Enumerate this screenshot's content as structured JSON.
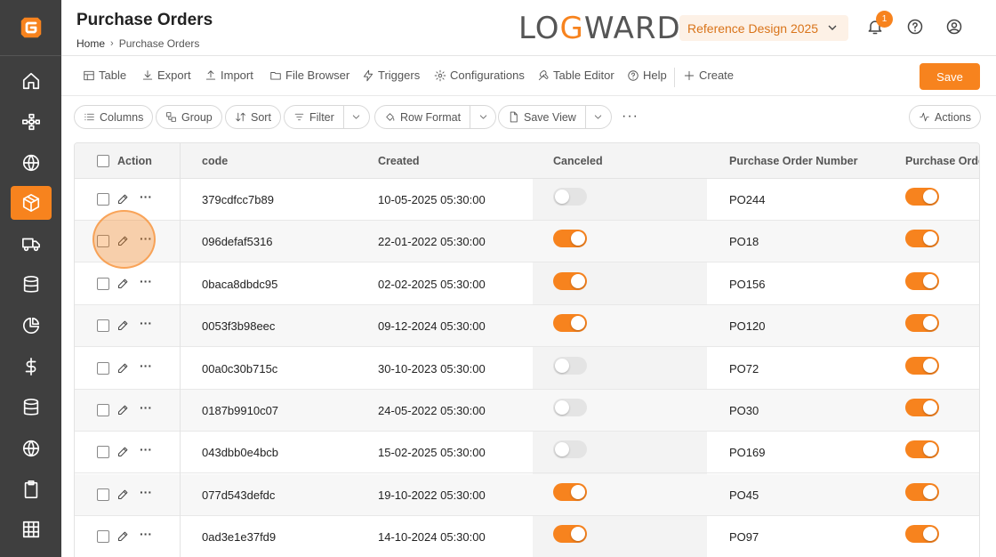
{
  "header": {
    "title": "Purchase Orders",
    "breadcrumb": {
      "home": "Home",
      "current": "Purchase Orders"
    },
    "brand_prefix": "LO",
    "brand_g": "G",
    "brand_suffix": "WARD",
    "reference_select": "Reference Design 2025",
    "notification_count": "1"
  },
  "toolbar": {
    "table": "Table",
    "export": "Export",
    "import": "Import",
    "file_browser": "File Browser",
    "triggers": "Triggers",
    "configurations": "Configurations",
    "table_editor": "Table Editor",
    "help": "Help",
    "create": "Create",
    "save": "Save"
  },
  "filterbar": {
    "columns": "Columns",
    "group": "Group",
    "sort": "Sort",
    "filter": "Filter",
    "row_format": "Row Format",
    "save_view": "Save View",
    "more": "···",
    "actions": "Actions"
  },
  "table": {
    "columns": [
      "Action",
      "code",
      "Created",
      "Canceled",
      "Purchase Order Number",
      "Purchase Order"
    ],
    "rows": [
      {
        "code": "379cdfcc7b89",
        "created": "10-05-2025 05:30:00",
        "canceled": false,
        "po_number": "PO244",
        "po": true
      },
      {
        "code": "096defaf5316",
        "created": "22-01-2022 05:30:00",
        "canceled": true,
        "po_number": "PO18",
        "po": true
      },
      {
        "code": "0baca8dbdc95",
        "created": "02-02-2025 05:30:00",
        "canceled": true,
        "po_number": "PO156",
        "po": true
      },
      {
        "code": "0053f3b98eec",
        "created": "09-12-2024 05:30:00",
        "canceled": true,
        "po_number": "PO120",
        "po": true
      },
      {
        "code": "00a0c30b715c",
        "created": "30-10-2023 05:30:00",
        "canceled": false,
        "po_number": "PO72",
        "po": true
      },
      {
        "code": "0187b9910c07",
        "created": "24-05-2022 05:30:00",
        "canceled": false,
        "po_number": "PO30",
        "po": true
      },
      {
        "code": "043dbb0e4bcb",
        "created": "15-02-2025 05:30:00",
        "canceled": false,
        "po_number": "PO169",
        "po": true
      },
      {
        "code": "077d543defdc",
        "created": "19-10-2022 05:30:00",
        "canceled": true,
        "po_number": "PO45",
        "po": true
      },
      {
        "code": "0ad3e1e37fd9",
        "created": "14-10-2024 05:30:00",
        "canceled": true,
        "po_number": "PO97",
        "po": true
      }
    ]
  },
  "colors": {
    "accent": "#f7831e",
    "sidebar": "#3f3f3f"
  }
}
